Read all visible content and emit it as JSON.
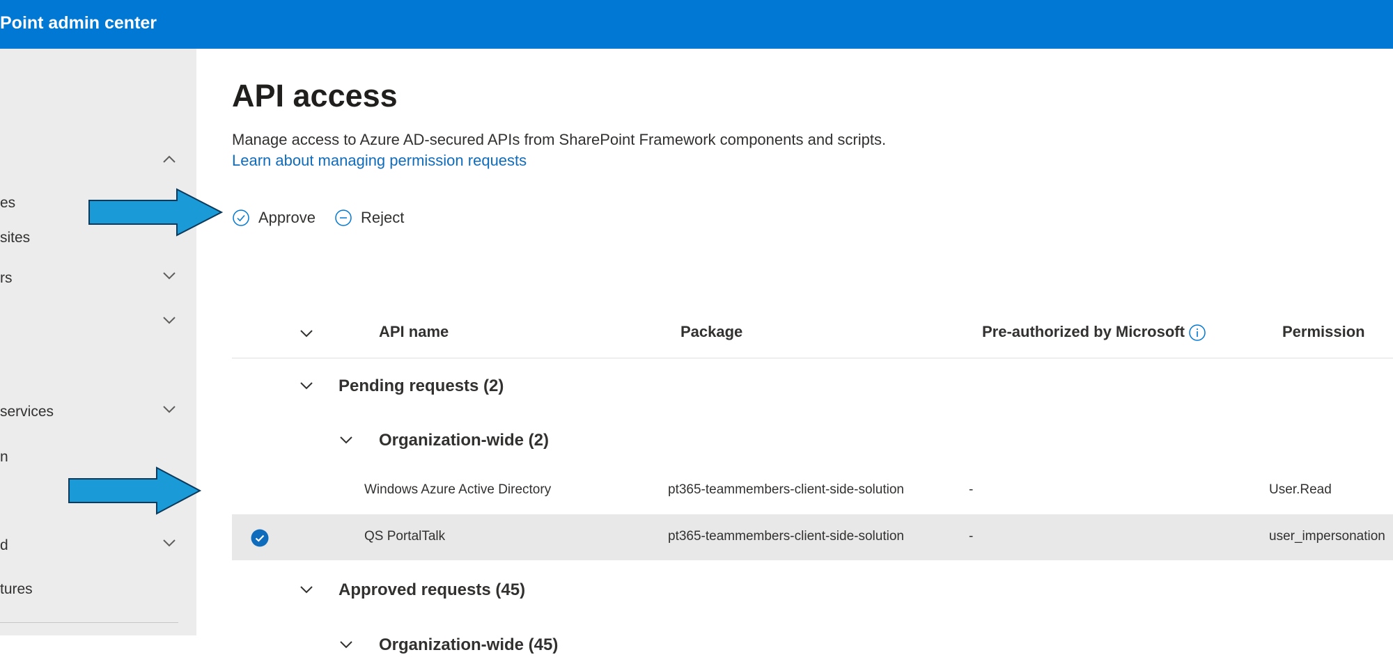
{
  "header": {
    "title": "Point admin center"
  },
  "sidebar": {
    "items": [
      {
        "label": "es",
        "chevron": ""
      },
      {
        "label": "sites",
        "chevron": ""
      },
      {
        "label": "rs",
        "chevron": "down"
      },
      {
        "label": "",
        "chevron": "down"
      },
      {
        "label": "services",
        "chevron": "down"
      },
      {
        "label": "n",
        "chevron": ""
      },
      {
        "label": "d",
        "chevron": "down"
      },
      {
        "label": "tures",
        "chevron": ""
      }
    ]
  },
  "page": {
    "title": "API access",
    "description": "Manage access to Azure AD-secured APIs from SharePoint Framework components and scripts.",
    "learn_link": "Learn about managing permission requests"
  },
  "commands": {
    "approve": "Approve",
    "reject": "Reject"
  },
  "table": {
    "columns": [
      "API name",
      "Package",
      "Pre-authorized by Microsoft",
      "Permission"
    ],
    "groups": {
      "pending": "Pending requests (2)",
      "pending_org": "Organization-wide (2)",
      "approved": "Approved requests (45)",
      "approved_org": "Organization-wide (45)"
    },
    "rows": [
      {
        "api_name": "Windows Azure Active Directory",
        "package": "pt365-teammembers-client-side-solution",
        "preauthorized": "-",
        "permission": "User.Read",
        "selected": false
      },
      {
        "api_name": "QS PortalTalk",
        "package": "pt365-teammembers-client-side-solution",
        "preauthorized": "-",
        "permission": "user_impersonation",
        "selected": true
      }
    ]
  },
  "colors": {
    "header_bg": "#0078d4",
    "sidebar_bg": "#ececec",
    "link": "#0f6cbd",
    "annotation_arrow": "#1a9ad6",
    "selected_row": "#e8e8e8"
  },
  "icons": [
    "chevron-up-icon",
    "chevron-down-icon",
    "approve-check-icon",
    "reject-minus-icon",
    "info-icon",
    "selected-check-icon",
    "annotation-arrow"
  ]
}
